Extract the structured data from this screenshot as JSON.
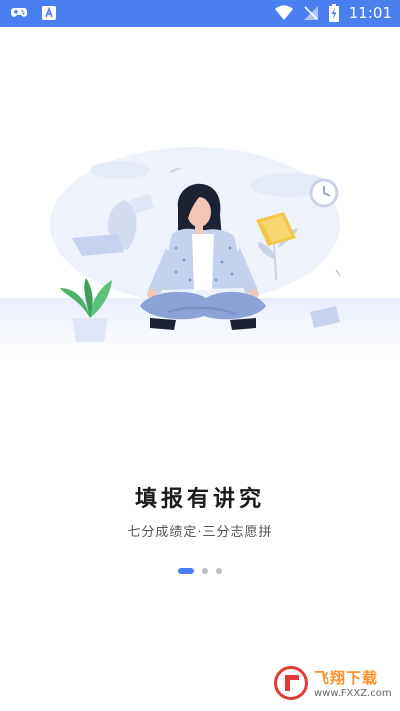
{
  "status_bar": {
    "time": "11:01",
    "left_icons": [
      "gamepad-icon",
      "text-a-icon"
    ],
    "right_icons": [
      "wifi-icon",
      "no-signal-icon",
      "battery-charging-icon"
    ],
    "accent": "#4a7ff0"
  },
  "onboarding": {
    "title": "填报有讲究",
    "subtitle": "七分成绩定·三分志愿拼",
    "page_indicator": {
      "current": 1,
      "total": 3
    }
  },
  "watermark": {
    "name": "飞翔下载",
    "url": "www.FXXZ.com"
  }
}
